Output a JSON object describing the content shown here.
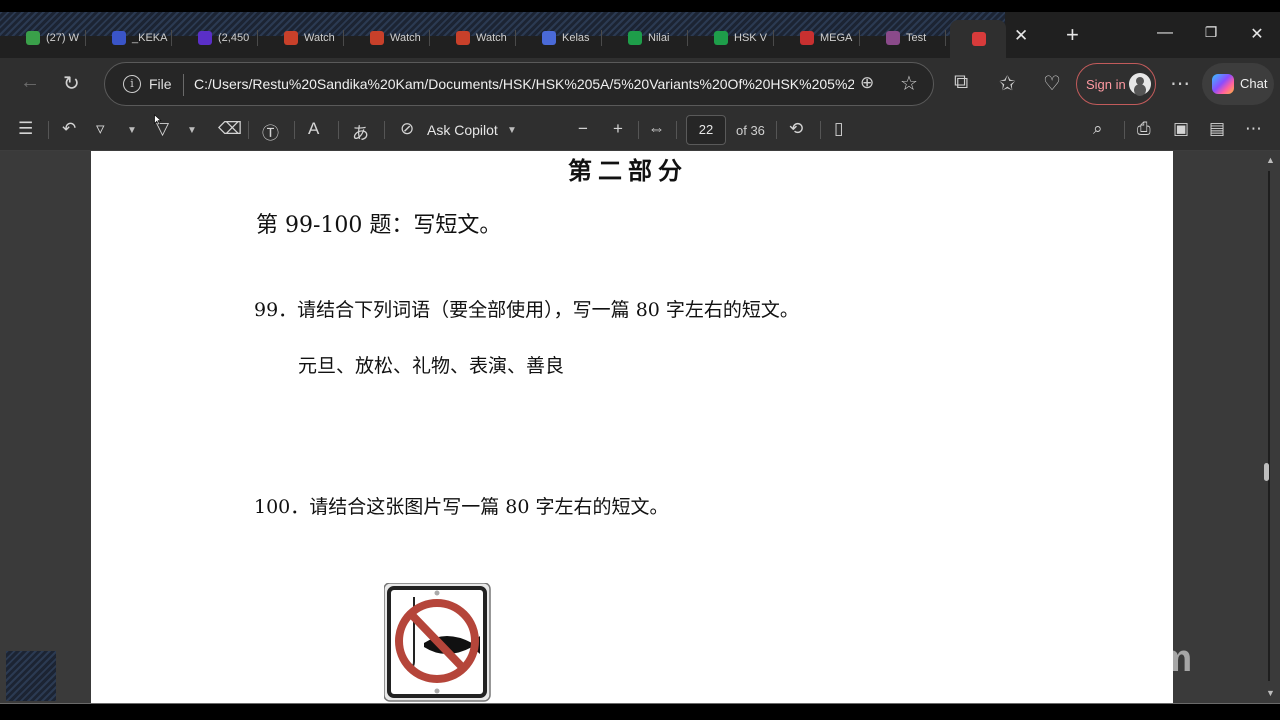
{
  "tabs": [
    {
      "label": "(27) W",
      "color": "#3aa04a"
    },
    {
      "label": "_KEKA",
      "color": "#3a55c8"
    },
    {
      "label": "(2,450",
      "color": "#5a2fc8"
    },
    {
      "label": "Watch",
      "color": "#c8402a"
    },
    {
      "label": "Watch",
      "color": "#c8402a"
    },
    {
      "label": "Watch",
      "color": "#c8402a"
    },
    {
      "label": "Kelas",
      "color": "#4a6ad8"
    },
    {
      "label": "Nilai",
      "color": "#1e9e4a"
    },
    {
      "label": "HSK V",
      "color": "#1e9e4a"
    },
    {
      "label": "MEGA",
      "color": "#c83030"
    },
    {
      "label": "Test",
      "color": "#8a4a8a"
    },
    {
      "label": "",
      "color": "#d83b3b"
    }
  ],
  "address": {
    "scheme_label": "File",
    "url": "C:/Users/Restu%20Sandika%20Kam/Documents/HSK/HSK%205A/5%20Variants%20Of%20HSK%205%20..."
  },
  "account": {
    "signin_label": "Sign in"
  },
  "copilot_chat": {
    "label": "Chat"
  },
  "pdf_toolbar": {
    "ask_copilot": "Ask Copilot",
    "page_current": "22",
    "page_total": "of 36"
  },
  "document": {
    "part_title": "第二部分",
    "section_heading": "第 99-100 题：写短文。",
    "q99": "99．请结合下列词语（要全部使用），写一篇 80 字左右的短文。",
    "q99_words": "元旦、放松、礼物、表演、善良",
    "q100": "100．请结合这张图片写一篇 80 字左右的短文。"
  },
  "watermark": "zoom",
  "colors": {
    "accent_signin": "#c25b5b",
    "tab_bg": "#202020",
    "toolbar_bg": "#2f2f2f"
  }
}
